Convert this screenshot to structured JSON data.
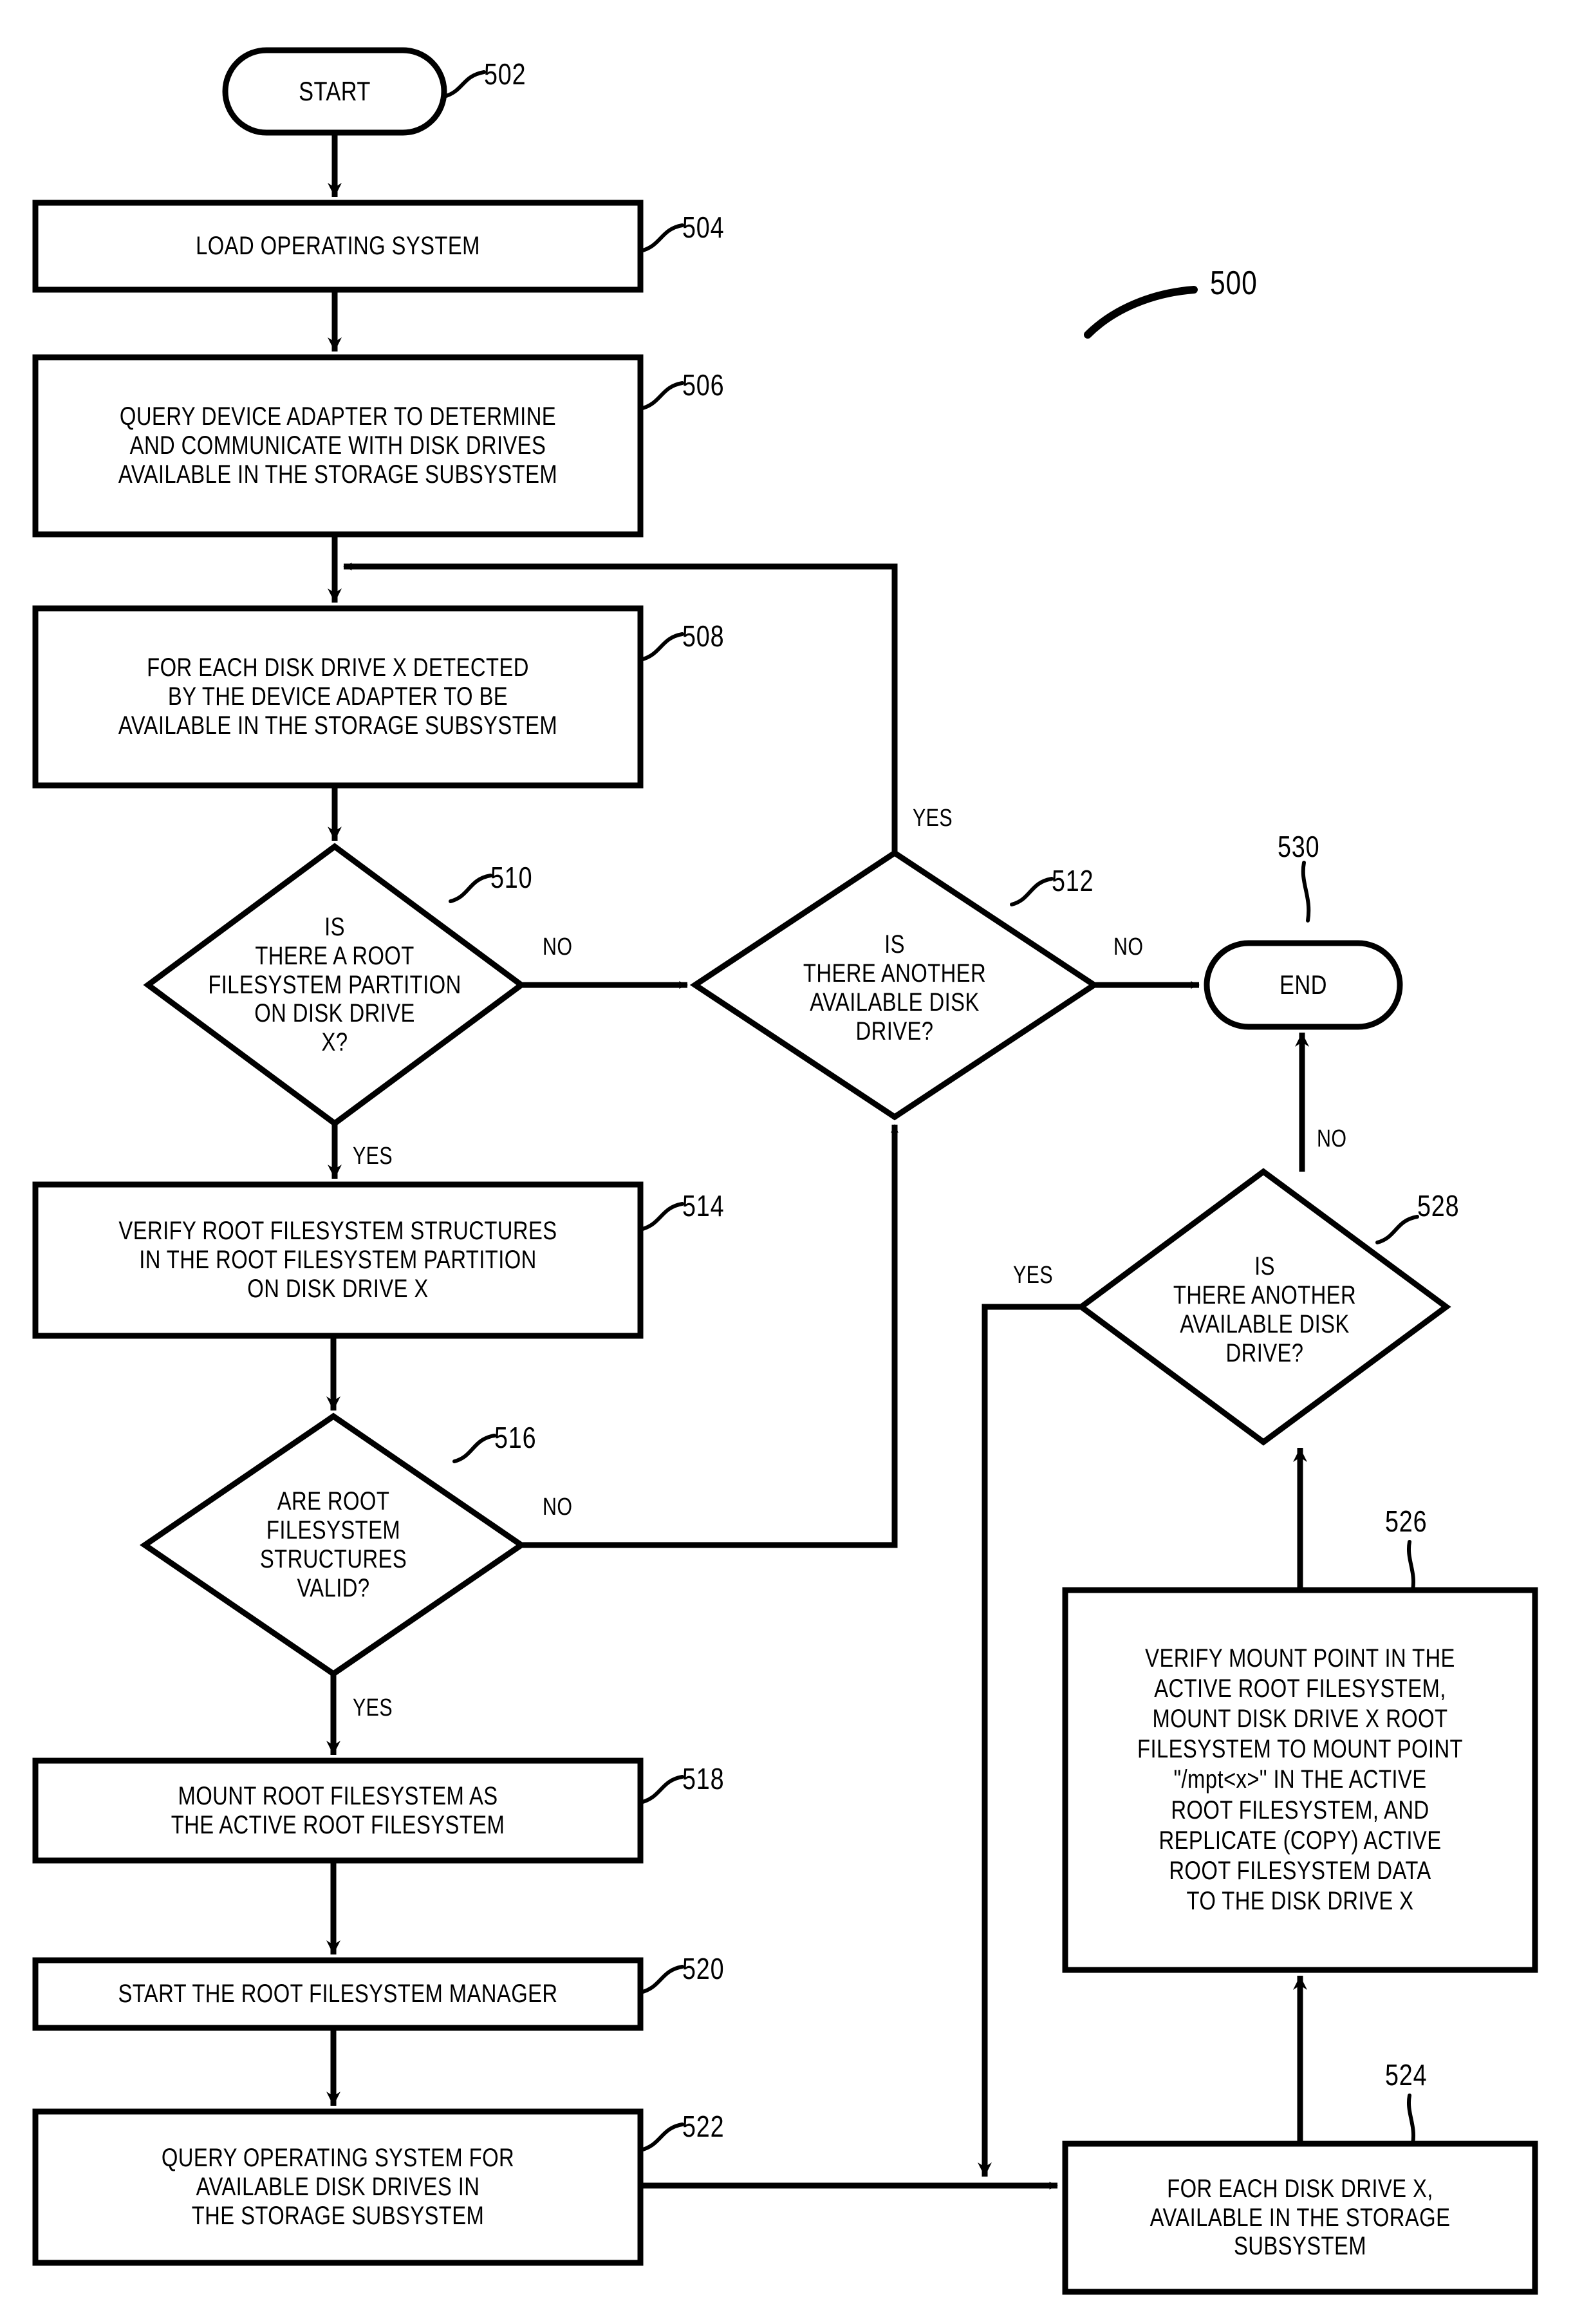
{
  "figure": {
    "figure_ref": "500"
  },
  "nodes": [
    {
      "id": "502",
      "ref": "502",
      "shape": "terminator",
      "label": "START"
    },
    {
      "id": "504",
      "ref": "504",
      "shape": "process",
      "label": "LOAD OPERATING SYSTEM"
    },
    {
      "id": "506",
      "ref": "506",
      "shape": "process",
      "label": "QUERY DEVICE ADAPTER TO DETERMINE\nAND COMMUNICATE WITH DISK DRIVES\nAVAILABLE IN THE STORAGE SUBSYSTEM"
    },
    {
      "id": "508",
      "ref": "508",
      "shape": "process",
      "label": "FOR EACH DISK DRIVE X DETECTED\nBY THE DEVICE ADAPTER TO BE\nAVAILABLE IN THE STORAGE SUBSYSTEM"
    },
    {
      "id": "510",
      "ref": "510",
      "shape": "decision",
      "label": "IS\nTHERE A ROOT\nFILESYSTEM PARTITION\nON DISK DRIVE\nX?"
    },
    {
      "id": "512",
      "ref": "512",
      "shape": "decision",
      "label": "IS\nTHERE ANOTHER\nAVAILABLE DISK\nDRIVE?"
    },
    {
      "id": "514",
      "ref": "514",
      "shape": "process",
      "label": "VERIFY ROOT FILESYSTEM STRUCTURES\nIN THE ROOT FILESYSTEM PARTITION\nON DISK DRIVE X"
    },
    {
      "id": "516",
      "ref": "516",
      "shape": "decision",
      "label": "ARE ROOT\nFILESYSTEM\nSTRUCTURES\nVALID?"
    },
    {
      "id": "518",
      "ref": "518",
      "shape": "process",
      "label": "MOUNT ROOT FILESYSTEM AS\nTHE ACTIVE ROOT FILESYSTEM"
    },
    {
      "id": "520",
      "ref": "520",
      "shape": "process",
      "label": "START THE ROOT FILESYSTEM MANAGER"
    },
    {
      "id": "522",
      "ref": "522",
      "shape": "process",
      "label": "QUERY OPERATING SYSTEM FOR\nAVAILABLE DISK DRIVES IN\nTHE STORAGE SUBSYSTEM"
    },
    {
      "id": "524",
      "ref": "524",
      "shape": "process",
      "label": "FOR EACH DISK DRIVE X,\nAVAILABLE IN THE STORAGE\nSUBSYSTEM"
    },
    {
      "id": "526",
      "ref": "526",
      "shape": "process",
      "label": "VERIFY MOUNT POINT IN THE\nACTIVE ROOT FILESYSTEM,\nMOUNT DISK DRIVE X ROOT\nFILESYSTEM TO MOUNT POINT\n\"/mpt<x>\" IN THE ACTIVE\nROOT FILESYSTEM, AND\nREPLICATE (COPY) ACTIVE\nROOT FILESYSTEM DATA\nTO THE DISK DRIVE X"
    },
    {
      "id": "528",
      "ref": "528",
      "shape": "decision",
      "label": "IS\nTHERE ANOTHER\nAVAILABLE DISK\nDRIVE?"
    },
    {
      "id": "530",
      "ref": "530",
      "shape": "terminator",
      "label": "END"
    }
  ],
  "edge_labels": {
    "e510_no": "NO",
    "e510_yes": "YES",
    "e512_yes": "YES",
    "e512_no": "NO",
    "e516_no": "NO",
    "e516_yes": "YES",
    "e528_no": "NO",
    "e528_yes": "YES"
  },
  "colors": {
    "stroke": "#000000",
    "fill": "#ffffff",
    "text": "#000000"
  }
}
